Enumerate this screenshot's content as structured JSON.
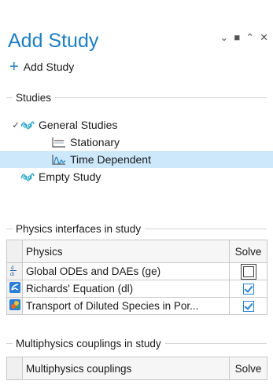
{
  "window": {
    "title": "Add Study"
  },
  "toolbar": {
    "add_study_label": "Add Study"
  },
  "studies": {
    "section_label": "Studies",
    "tree": [
      {
        "label": "General Studies",
        "icon": "general-studies-icon",
        "level": 0,
        "expanded": true
      },
      {
        "label": "Stationary",
        "icon": "stationary-icon",
        "level": 1
      },
      {
        "label": "Time Dependent",
        "icon": "time-dependent-icon",
        "level": 1,
        "selected": true
      },
      {
        "label": "Empty Study",
        "icon": "empty-study-icon",
        "level": 0
      }
    ]
  },
  "physics": {
    "section_label": "Physics interfaces in study",
    "columns": [
      "Physics",
      "Solve"
    ],
    "rows": [
      {
        "icon": "ode-icon",
        "label": "Global ODEs and DAEs (ge)",
        "solve": false
      },
      {
        "icon": "richards-equation-icon",
        "label": "Richards' Equation (dl)",
        "solve": true
      },
      {
        "icon": "transport-species-icon",
        "label": "Transport of Diluted Species in Por...",
        "solve": true
      }
    ]
  },
  "multiphysics": {
    "section_label": "Multiphysics couplings in study",
    "columns": [
      "Multiphysics couplings",
      "Solve"
    ]
  },
  "colors": {
    "accent": "#1e7fc3",
    "selection": "#cde8fb",
    "check": "#2a7fd4"
  }
}
